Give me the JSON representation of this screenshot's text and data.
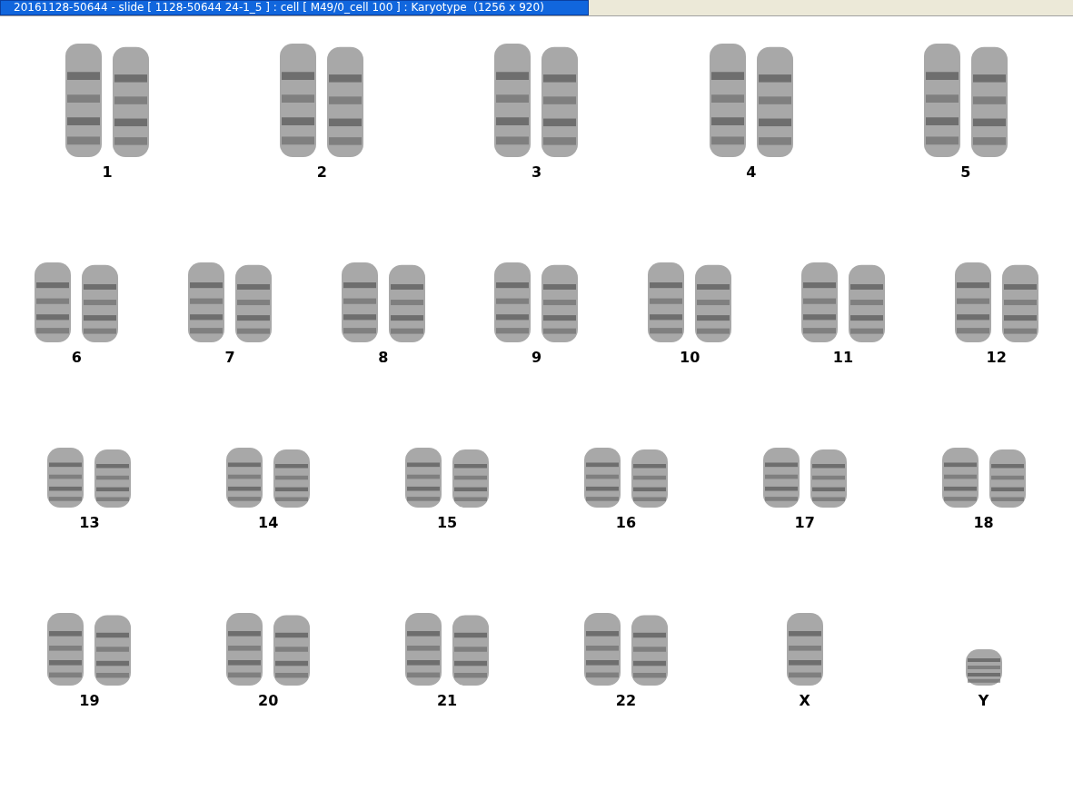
{
  "window": {
    "title": "20161128-50644 - slide [ 1128-50644 24-1_5 ] : cell [ M49/0_cell 100 ] : Karyotype  (1256 x 920)"
  },
  "karyotype": {
    "rows": [
      {
        "items": [
          {
            "label": "1",
            "kind": "pair"
          },
          {
            "label": "2",
            "kind": "pair"
          },
          {
            "label": "3",
            "kind": "pair"
          },
          {
            "label": "4",
            "kind": "pair"
          },
          {
            "label": "5",
            "kind": "pair"
          }
        ]
      },
      {
        "items": [
          {
            "label": "6",
            "kind": "pair"
          },
          {
            "label": "7",
            "kind": "pair"
          },
          {
            "label": "8",
            "kind": "pair"
          },
          {
            "label": "9",
            "kind": "pair"
          },
          {
            "label": "10",
            "kind": "pair"
          },
          {
            "label": "11",
            "kind": "pair"
          },
          {
            "label": "12",
            "kind": "pair"
          }
        ]
      },
      {
        "items": [
          {
            "label": "13",
            "kind": "pair"
          },
          {
            "label": "14",
            "kind": "pair"
          },
          {
            "label": "15",
            "kind": "pair"
          },
          {
            "label": "16",
            "kind": "pair"
          },
          {
            "label": "17",
            "kind": "pair"
          },
          {
            "label": "18",
            "kind": "pair"
          }
        ]
      },
      {
        "items": [
          {
            "label": "19",
            "kind": "pair"
          },
          {
            "label": "20",
            "kind": "pair"
          },
          {
            "label": "21",
            "kind": "pair"
          },
          {
            "label": "22",
            "kind": "pair"
          },
          {
            "label": "X",
            "kind": "single"
          },
          {
            "label": "Y",
            "kind": "single"
          }
        ]
      }
    ]
  }
}
